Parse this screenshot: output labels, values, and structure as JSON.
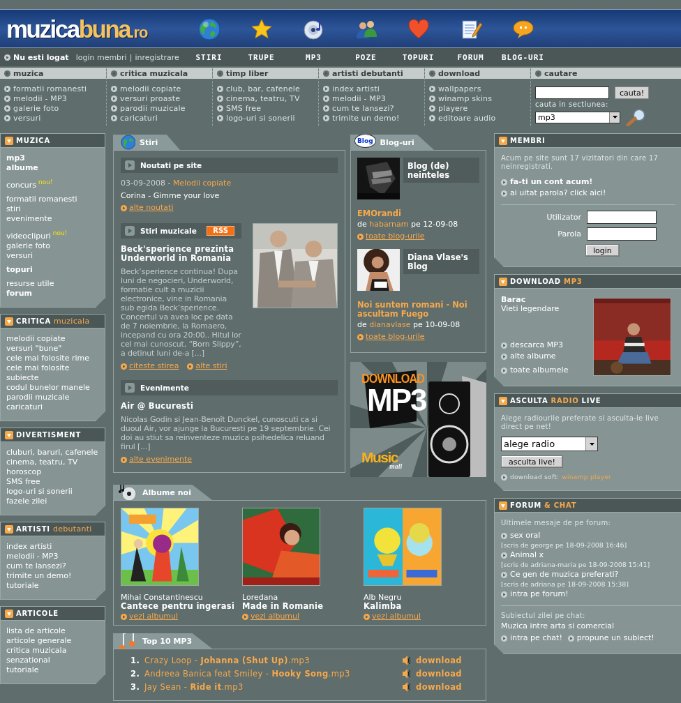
{
  "header": {
    "logo": {
      "first": "muzica",
      "second": "buna",
      "suffix": ".ro"
    },
    "nav": [
      {
        "label": "STIRI"
      },
      {
        "label": "TRUPE"
      },
      {
        "label": "MP3"
      },
      {
        "label": "POZE"
      },
      {
        "label": "TOPURI"
      },
      {
        "label": "FORUM"
      },
      {
        "label": "BLOG-URI"
      }
    ],
    "user_bar": {
      "status": "Nu esti logat",
      "links": [
        "login membri",
        "inregistrare"
      ],
      "separator": "|"
    }
  },
  "categories": [
    {
      "title": "muzica",
      "links": [
        "formatii romanesti",
        "melodii - MP3",
        "galerie foto",
        "versuri"
      ]
    },
    {
      "title": "critica muzicala",
      "links": [
        "melodii copiate",
        "versuri proaste",
        "parodii muzicale",
        "caricaturi"
      ]
    },
    {
      "title": "timp liber",
      "links": [
        "club, bar, cafenele",
        "cinema, teatru, TV",
        "SMS free",
        "logo-uri si sonerii"
      ]
    },
    {
      "title": "artisti debutanti",
      "links": [
        "index artisti",
        "melodii - MP3",
        "cum te lansezi?",
        "trimite un demo!"
      ]
    },
    {
      "title": "download",
      "links": [
        "wallpapers",
        "winamp skins",
        "playere",
        "editoare audio"
      ]
    }
  ],
  "search": {
    "title": "cautare",
    "button": "cauta!",
    "section_label": "cauta in sectiunea:",
    "section": "mp3"
  },
  "left_sidebar": [
    {
      "title": [
        {
          "text": "MUZICA",
          "accent": false
        }
      ],
      "groups": [
        [
          {
            "label": "mp3",
            "bold": true
          },
          {
            "label": "albume",
            "bold": true
          }
        ],
        [
          {
            "label": "concurs",
            "bold": false,
            "badge": "nou!"
          }
        ],
        [
          {
            "label": "formatii romanesti",
            "bold": false
          },
          {
            "label": "stiri",
            "bold": false
          },
          {
            "label": "evenimente",
            "bold": false
          }
        ],
        [
          {
            "label": "videoclipuri",
            "bold": false,
            "badge": "nou!"
          },
          {
            "label": "galerie foto",
            "bold": false
          },
          {
            "label": "versuri",
            "bold": false
          }
        ],
        [
          {
            "label": "topuri",
            "bold": true
          }
        ],
        [
          {
            "label": "resurse utile",
            "bold": false
          },
          {
            "label": "forum",
            "bold": true
          }
        ]
      ]
    },
    {
      "title": [
        {
          "text": "CRITICA",
          "accent": false
        },
        {
          "text": "muzicala",
          "accent": true
        }
      ],
      "groups": [
        [
          {
            "label": "melodii copiate",
            "bold": false
          },
          {
            "label": "versuri \"bune\"",
            "bold": false
          },
          {
            "label": "cele mai folosite rime",
            "bold": false
          },
          {
            "label": "cele mai folosite subiecte",
            "bold": false
          },
          {
            "label": "codul bunelor manele",
            "bold": false
          },
          {
            "label": "parodii muzicale",
            "bold": false
          },
          {
            "label": "caricaturi",
            "bold": false
          }
        ]
      ]
    },
    {
      "title": [
        {
          "text": "DIVERTISMENT",
          "accent": false
        }
      ],
      "groups": [
        [
          {
            "label": "cluburi, baruri, cafenele",
            "bold": false
          },
          {
            "label": "cinema, teatru, TV",
            "bold": false
          },
          {
            "label": "horoscop",
            "bold": false
          },
          {
            "label": "SMS free",
            "bold": false
          },
          {
            "label": "logo-uri si sonerii",
            "bold": false
          },
          {
            "label": "fazele zilei",
            "bold": false
          }
        ]
      ]
    },
    {
      "title": [
        {
          "text": "ARTISTI",
          "accent": false
        },
        {
          "text": "debutanti",
          "accent": true
        }
      ],
      "groups": [
        [
          {
            "label": "index artisti",
            "bold": false
          },
          {
            "label": "melodii - MP3",
            "bold": false
          },
          {
            "label": "cum te lansezi?",
            "bold": false
          },
          {
            "label": "trimite un demo!",
            "bold": false
          },
          {
            "label": "tutoriale",
            "bold": false
          }
        ]
      ]
    },
    {
      "title": [
        {
          "text": "ARTICOLE",
          "accent": false
        }
      ],
      "groups": [
        [
          {
            "label": "lista de articole",
            "bold": false
          },
          {
            "label": "articole generale",
            "bold": false
          },
          {
            "label": "critica muzicala",
            "bold": false
          },
          {
            "label": "senzational",
            "bold": false
          },
          {
            "label": "tutoriale",
            "bold": false
          }
        ]
      ]
    }
  ],
  "news": {
    "title": "Stiri",
    "site_news": {
      "heading": "Noutati pe site",
      "date": "03-09-2008 -",
      "category": "Melodii copiate",
      "item": "Corina - Gimme your love",
      "link": "alte noutati"
    },
    "music_news": {
      "heading": "Stiri muzicale",
      "rss": "RSS",
      "headline": "Beck'sperience prezinta Underworld in Romania",
      "body": "Beck’sperience continua! Dupa luni de negocieri, Underworld, formatie cult a muzicii electronice, vine in Romania sub egida Beck’sperience. Concertul va avea loc pe data de 7 noiembrie, la Romaero, incepand cu ora 20:00.. Hitul lor cel mai cunoscut, “Born Slippy”, a detinut luni de-a [...]",
      "links": [
        "citeste stirea",
        "alte stiri"
      ]
    },
    "events": {
      "heading": "Evenimente",
      "headline": "Air @ Bucuresti",
      "body": "Nicolas Godin si Jean-Benoît Dunckel, cunoscuti ca si duoul Air, vor ajunge la Bucuresti pe 19 septembrie. Cei doi au stiut sa reinventeze muzica psihedelica reluand firul [...]",
      "links": [
        "alte evenimente"
      ]
    }
  },
  "blogs": {
    "title": "Blog-uri",
    "badge": "Blog",
    "items": [
      {
        "name": "Blog (de) neinteles",
        "post": "EMOrandi",
        "by": "de",
        "author": "habarnam",
        "date": "pe 12-09-08",
        "link": "toate blog-urile"
      },
      {
        "name": "Diana Vlase's Blog",
        "post": "Noi suntem romani - Noi ascultam Fuego",
        "by": "de",
        "author": "dianavlase",
        "date": "pe 10-09-08",
        "link": "toate blog-urile"
      }
    ]
  },
  "banner": {
    "headline": "DOWNLOAD",
    "big": "MP3",
    "brand": "Music",
    "brand_tail": "mall"
  },
  "albums": {
    "title": "Albume noi",
    "items": [
      {
        "artist": "Mihai Constantinescu",
        "title": "Cantece pentru ingerasi",
        "link": "vezi albumul"
      },
      {
        "artist": "Loredana",
        "title": "Made in Romanie",
        "link": "vezi albumul"
      },
      {
        "artist": "Alb Negru",
        "title": "Kalimba",
        "link": "vezi albumul"
      }
    ]
  },
  "top_mp3": {
    "title": "Top 10 MP3",
    "items": [
      {
        "rank": "1.",
        "song": "Crazy Loop - **Johanna (Shut Up)**.mp3",
        "action": "download"
      },
      {
        "rank": "2.",
        "song": "Andreea Banica feat Smiley - **Hooky Song**.mp3",
        "action": "download"
      },
      {
        "rank": "3.",
        "song": "Jay Sean - **Ride it**.mp3",
        "action": "download"
      }
    ]
  },
  "members": {
    "title": [
      {
        "text": "MEMBRI",
        "accent": false
      }
    ],
    "text": "Acum pe site sunt 17 vizitatori din care 17 neinregistrati.",
    "links": [
      {
        "label": "fa-ti un cont acum!",
        "bold": true
      },
      {
        "label": "ai uitat parola? click aici!",
        "bold": false
      }
    ],
    "fields": [
      "Utilizator",
      "Parola"
    ],
    "button": "login"
  },
  "download": {
    "title": [
      {
        "text": "DOWNLOAD",
        "accent": false
      },
      {
        "text": "MP3",
        "accent": true
      }
    ],
    "artist": "Barac",
    "album": "Vieti legendare",
    "links": [
      "descarca MP3",
      "alte albume",
      "toate albumele"
    ]
  },
  "radio": {
    "title": [
      {
        "text": "ASCULTA",
        "accent": false
      },
      {
        "text": "RADIO",
        "accent": true
      },
      {
        "text": "LIVE",
        "accent": false
      }
    ],
    "text": "Alege radiourile preferate si asculta-le live direct pe net!",
    "select": "alege radio",
    "button": "asculta live!",
    "soft_label": "download soft:",
    "soft_link": "winamp player"
  },
  "forum": {
    "title": [
      {
        "text": "FORUM",
        "accent": false
      },
      {
        "text": "&",
        "accent": true
      },
      {
        "text": "CHAT",
        "accent": true
      }
    ],
    "label": "Ultimele mesaje de pe forum:",
    "posts": [
      {
        "title": "sex oral",
        "meta": "[scris de george pe 18-09-2008 16:46]"
      },
      {
        "title": "Animal x",
        "meta": "[scris de adriana-maria pe 18-09-2008 15:41]"
      },
      {
        "title": "Ce gen de muzica preferati?",
        "meta": "[scris de adriana pe 18-09-2008 15:38]"
      }
    ],
    "forum_link": "intra pe forum!",
    "chat_label": "Subiectul zilei pe chat:",
    "chat_topic": "Muzica intre arta si comercial",
    "chat_links": [
      "intra pe chat!",
      "propune un subiect!"
    ]
  }
}
